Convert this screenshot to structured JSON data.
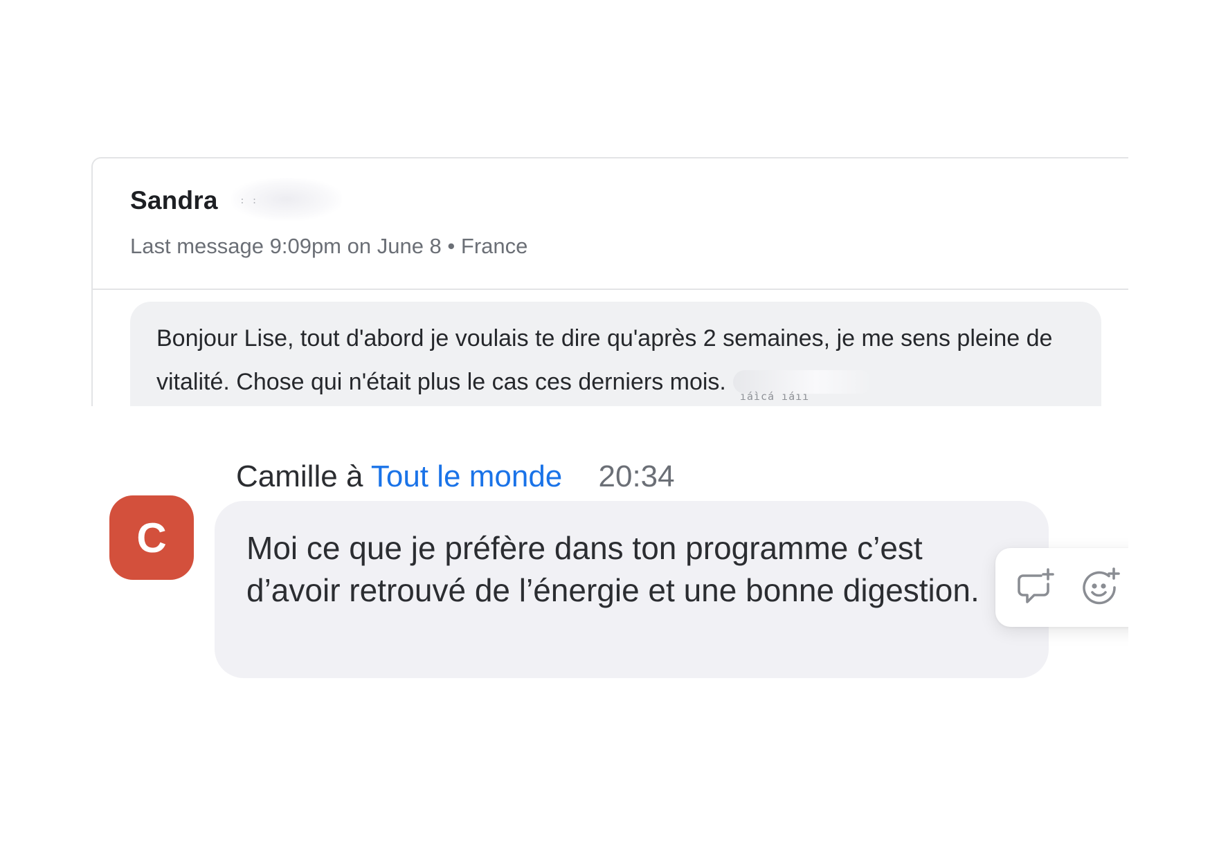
{
  "conversation": {
    "contact_name": "Sandra",
    "last_message_label": "Last message 9:09pm on June 8",
    "separator": "•",
    "location": "France",
    "preview_text": "Bonjour Lise, tout d'abord je voulais te dire qu'après 2 semaines, je me sens pleine de vitalité. Chose qui n'était plus le cas ces derniers mois."
  },
  "chat_message": {
    "avatar_initial": "C",
    "sender": "Camille",
    "to_word": "à",
    "recipient": "Tout le monde",
    "time": "20:34",
    "text": "Moi ce que je préfère dans ton programme c’est d’avoir retrouvé de l’énergie et une bonne digestion."
  },
  "actions": [
    {
      "name": "reply",
      "icon": "reply-bubble-plus-icon"
    },
    {
      "name": "reaction",
      "icon": "smiley-plus-icon"
    }
  ],
  "colors": {
    "avatar_bg": "#d3503c",
    "recipient_link": "#1a73e8",
    "bubble_bg": "#f1f1f5",
    "preview_bubble_bg": "#f0f1f3"
  }
}
